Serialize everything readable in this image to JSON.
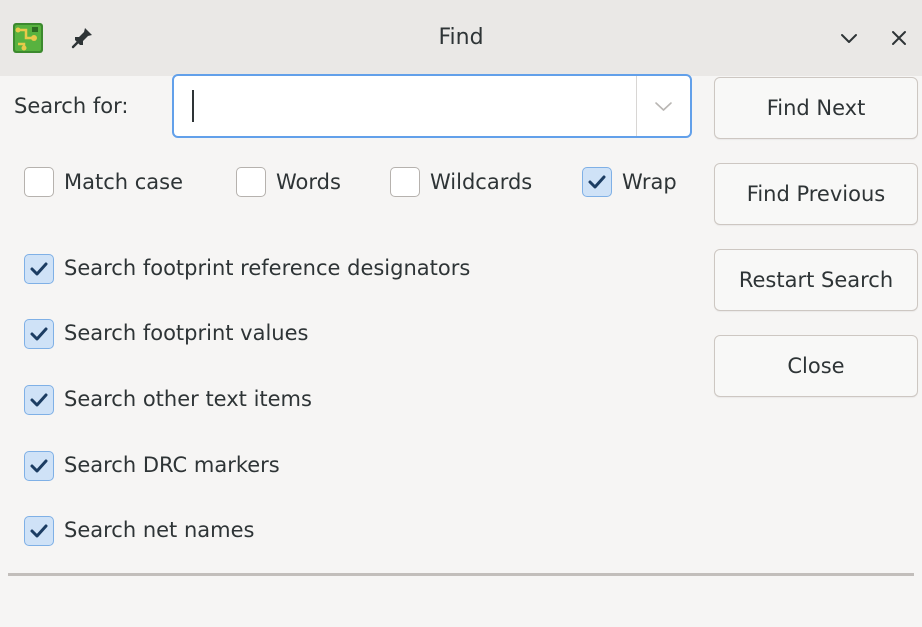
{
  "window": {
    "title": "Find",
    "icons": {
      "app": "kicad-pcb-icon",
      "pin": "pin-icon",
      "minimize": "chevron-down-icon",
      "close": "close-icon"
    }
  },
  "search": {
    "label": "Search for:",
    "value": "",
    "placeholder": ""
  },
  "options": {
    "match_case": {
      "label": "Match case",
      "checked": false
    },
    "words": {
      "label": "Words",
      "checked": false
    },
    "wildcards": {
      "label": "Wildcards",
      "checked": false
    },
    "wrap": {
      "label": "Wrap",
      "checked": true
    }
  },
  "filters": [
    {
      "label": "Search footprint reference designators",
      "checked": true
    },
    {
      "label": "Search footprint values",
      "checked": true
    },
    {
      "label": "Search other text items",
      "checked": true
    },
    {
      "label": "Search DRC markers",
      "checked": true
    },
    {
      "label": "Search net names",
      "checked": true
    }
  ],
  "buttons": {
    "find_next": "Find Next",
    "find_previous": "Find Previous",
    "restart_search": "Restart Search",
    "close": "Close"
  },
  "colors": {
    "accent": "#62a0ea",
    "checked_fill": "#cfe2f7",
    "window_bg": "#f6f5f4"
  }
}
